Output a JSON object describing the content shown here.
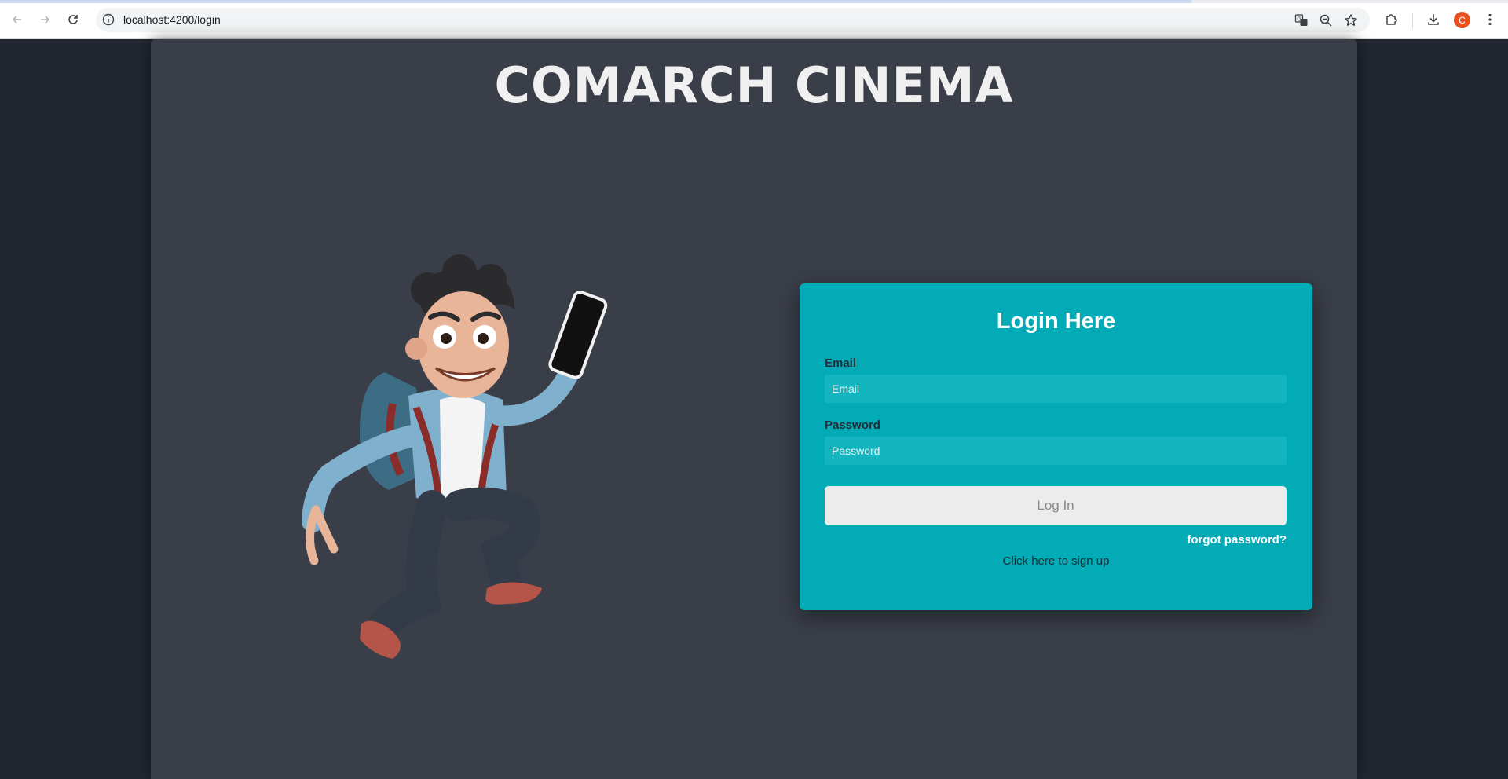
{
  "browser": {
    "url": "localhost:4200/login",
    "profile_initial": "C",
    "page_load_progress": 0.79,
    "icons": [
      "back-icon",
      "forward-icon",
      "reload-icon",
      "info-icon",
      "translate-icon",
      "zoom-icon",
      "bookmark-star-icon",
      "extensions-icon",
      "download-icon",
      "menu-icon"
    ]
  },
  "page": {
    "title": "COMARCH CINEMA"
  },
  "login": {
    "heading": "Login Here",
    "email_label": "Email",
    "email_placeholder": "Email",
    "email_value": "",
    "password_label": "Password",
    "password_placeholder": "Password",
    "password_value": "",
    "submit_label": "Log In",
    "forgot_label": "forgot password?",
    "signup_label": "Click here to sign up"
  },
  "colors": {
    "page_bg": "#212630",
    "panel_bg": "#3a3e48",
    "card_bg": "#02abb5",
    "avatar": "#e8501f"
  }
}
